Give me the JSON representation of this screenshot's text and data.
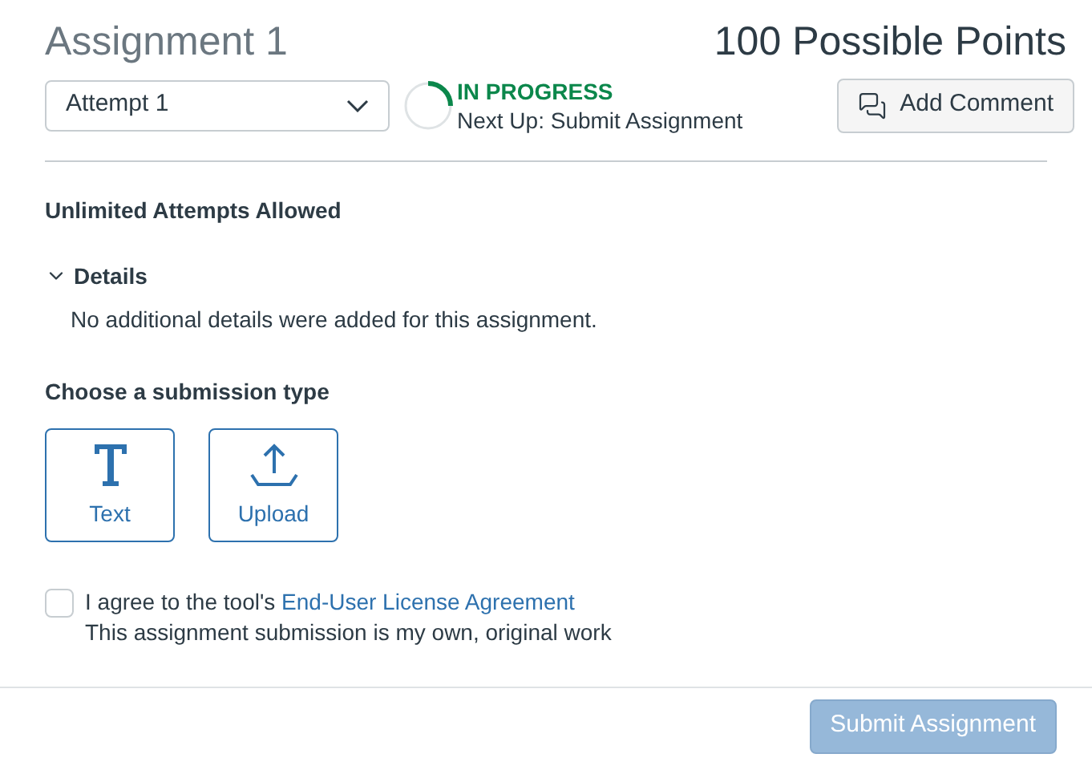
{
  "title": "Assignment 1",
  "points": "100 Possible Points",
  "attempt_select": {
    "value": "Attempt 1"
  },
  "status": {
    "label": "IN PROGRESS",
    "next": "Next Up: Submit Assignment"
  },
  "add_comment": "Add Comment",
  "attempts_note": "Unlimited Attempts Allowed",
  "details": {
    "label": "Details",
    "expanded": true,
    "text": "No additional details were added for this assignment."
  },
  "submission_types": {
    "heading": "Choose a submission type",
    "options": [
      {
        "kind": "text",
        "label": "Text",
        "selected": false
      },
      {
        "kind": "upload",
        "label": "Upload",
        "selected": false
      }
    ]
  },
  "agreement": {
    "checked": false,
    "prefix": "I agree to the tool's ",
    "link": "End-User License Agreement",
    "note": "This assignment submission is my own, original work"
  },
  "submit": {
    "label": "Submit Assignment",
    "disabled": true
  }
}
